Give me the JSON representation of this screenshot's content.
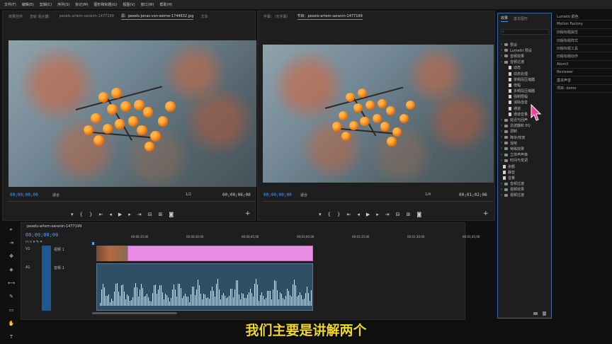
{
  "menu": [
    "文件(F)",
    "编辑(E)",
    "剪辑(C)",
    "序列(S)",
    "标记(M)",
    "图形和标题(G)",
    "视图(V)",
    "窗口(W)",
    "帮助(H)"
  ],
  "source_panel": {
    "tabs": [
      "效果控件",
      "音轨 混合器：",
      "pexels-artem-saranin-1477199",
      "源：pexels-jonas-von-werne-1744632.jpg",
      "文本"
    ],
    "timecode_left": "00;00;00;00",
    "fit": "适合",
    "ratio": "1/2",
    "timecode_right": "00;00;06;00"
  },
  "program_panel": {
    "tabs": [
      "字幕：（无字幕）",
      "节目：pexels-artem-saranin-1477199"
    ],
    "timecode_left": "00;00;00;00",
    "fit": "适合",
    "ratio": "1/4",
    "timecode_right": "00;01;02;06"
  },
  "effects_panel": {
    "tabs": [
      "效果",
      "基本图形"
    ],
    "items": [
      {
        "label": "预设",
        "type": "folder",
        "indent": 0
      },
      {
        "label": "Lumetri 预设",
        "type": "folder",
        "indent": 0
      },
      {
        "label": "音频效果",
        "type": "folder",
        "indent": 0
      },
      {
        "label": "音频过渡",
        "type": "folder",
        "indent": 0
      },
      {
        "label": "动态",
        "type": "file",
        "indent": 1
      },
      {
        "label": "动态处理",
        "type": "file",
        "indent": 1
      },
      {
        "label": "单频段压缩器",
        "type": "file",
        "indent": 1
      },
      {
        "label": "增幅",
        "type": "file",
        "indent": 1
      },
      {
        "label": "多频段压缩器",
        "type": "file",
        "indent": 1
      },
      {
        "label": "强制限幅",
        "type": "file",
        "indent": 1
      },
      {
        "label": "消除齿音",
        "type": "file",
        "indent": 1
      },
      {
        "label": "通道",
        "type": "file",
        "indent": 1
      },
      {
        "label": "通道音量",
        "type": "file",
        "indent": 1
      },
      {
        "label": "延迟与回声",
        "type": "folder",
        "indent": 0
      },
      {
        "label": "滤波器和 EQ",
        "type": "folder",
        "indent": 0
      },
      {
        "label": "调制",
        "type": "folder",
        "indent": 0
      },
      {
        "label": "降杂/恢复",
        "type": "folder",
        "indent": 0
      },
      {
        "label": "混响",
        "type": "folder",
        "indent": 0
      },
      {
        "label": "特殊效果",
        "type": "folder",
        "indent": 0
      },
      {
        "label": "立体声声像",
        "type": "folder",
        "indent": 0
      },
      {
        "label": "时间与变调",
        "type": "folder",
        "indent": 0
      },
      {
        "label": "余额",
        "type": "file",
        "indent": 0
      },
      {
        "label": "静音",
        "type": "file",
        "indent": 0
      },
      {
        "label": "音量",
        "type": "file",
        "indent": 0
      },
      {
        "label": "音频过渡",
        "type": "folder",
        "indent": 0
      },
      {
        "label": "视频效果",
        "type": "folder",
        "indent": 0
      },
      {
        "label": "视频过渡",
        "type": "folder",
        "indent": 0
      }
    ]
  },
  "right_panel": {
    "items": [
      "Lumetri 颜色",
      "Motion Factory",
      "旧版标题属性",
      "旧版标题样式",
      "旧版标题工具",
      "旧版标题动作",
      "AtomX",
      "Reviewer",
      "基本声音",
      "项目: demo"
    ]
  },
  "timeline": {
    "sequence_name": "pexels-artem-saranin-1477199",
    "timecode": "00;00;00;00",
    "ruler_labels": [
      "00;00;15;00",
      "00;00;30;00",
      "00;00;45;00",
      "00;01;00;00",
      "00;01;15;00",
      "00;01;30;00",
      "00;01;45;00"
    ],
    "tracks": [
      {
        "name": "V1",
        "label": "视频 1"
      },
      {
        "name": "A1",
        "label": "音频 1"
      }
    ]
  },
  "subtitle": "我们主要是讲解两个",
  "colors": {
    "accent": "#4aa0ff",
    "subtitle": "#f0d820",
    "video_clip": "#e98be3",
    "audio_clip": "#2f4f66"
  }
}
